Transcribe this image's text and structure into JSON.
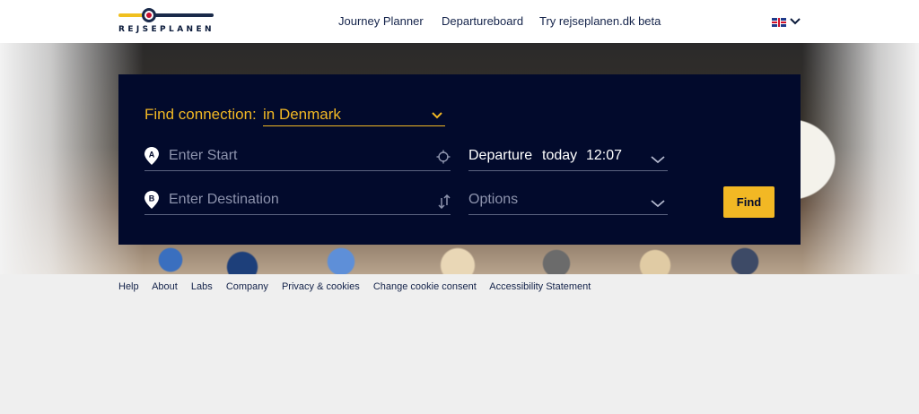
{
  "header": {
    "logo_text": "REJSEPLANEN",
    "nav": [
      "Journey Planner",
      "Departureboard",
      "Try rejseplanen.dk beta"
    ],
    "language_icon": "uk-flag-icon"
  },
  "search": {
    "find_connection_label": "Find connection:",
    "region": "in Denmark",
    "start_placeholder": "Enter Start",
    "start_marker": "A",
    "destination_placeholder": "Enter Destination",
    "destination_marker": "B",
    "departure": {
      "mode": "Departure",
      "day": "today",
      "time": "12:07"
    },
    "options_label": "Options",
    "find_button": "Find"
  },
  "footer": {
    "links": [
      "Help",
      "About",
      "Labs",
      "Company",
      "Privacy & cookies",
      "Change cookie consent",
      "Accessibility Statement"
    ]
  },
  "colors": {
    "panel_bg": "#020a2c",
    "accent": "#f2b824",
    "text_dark": "#14234a"
  }
}
